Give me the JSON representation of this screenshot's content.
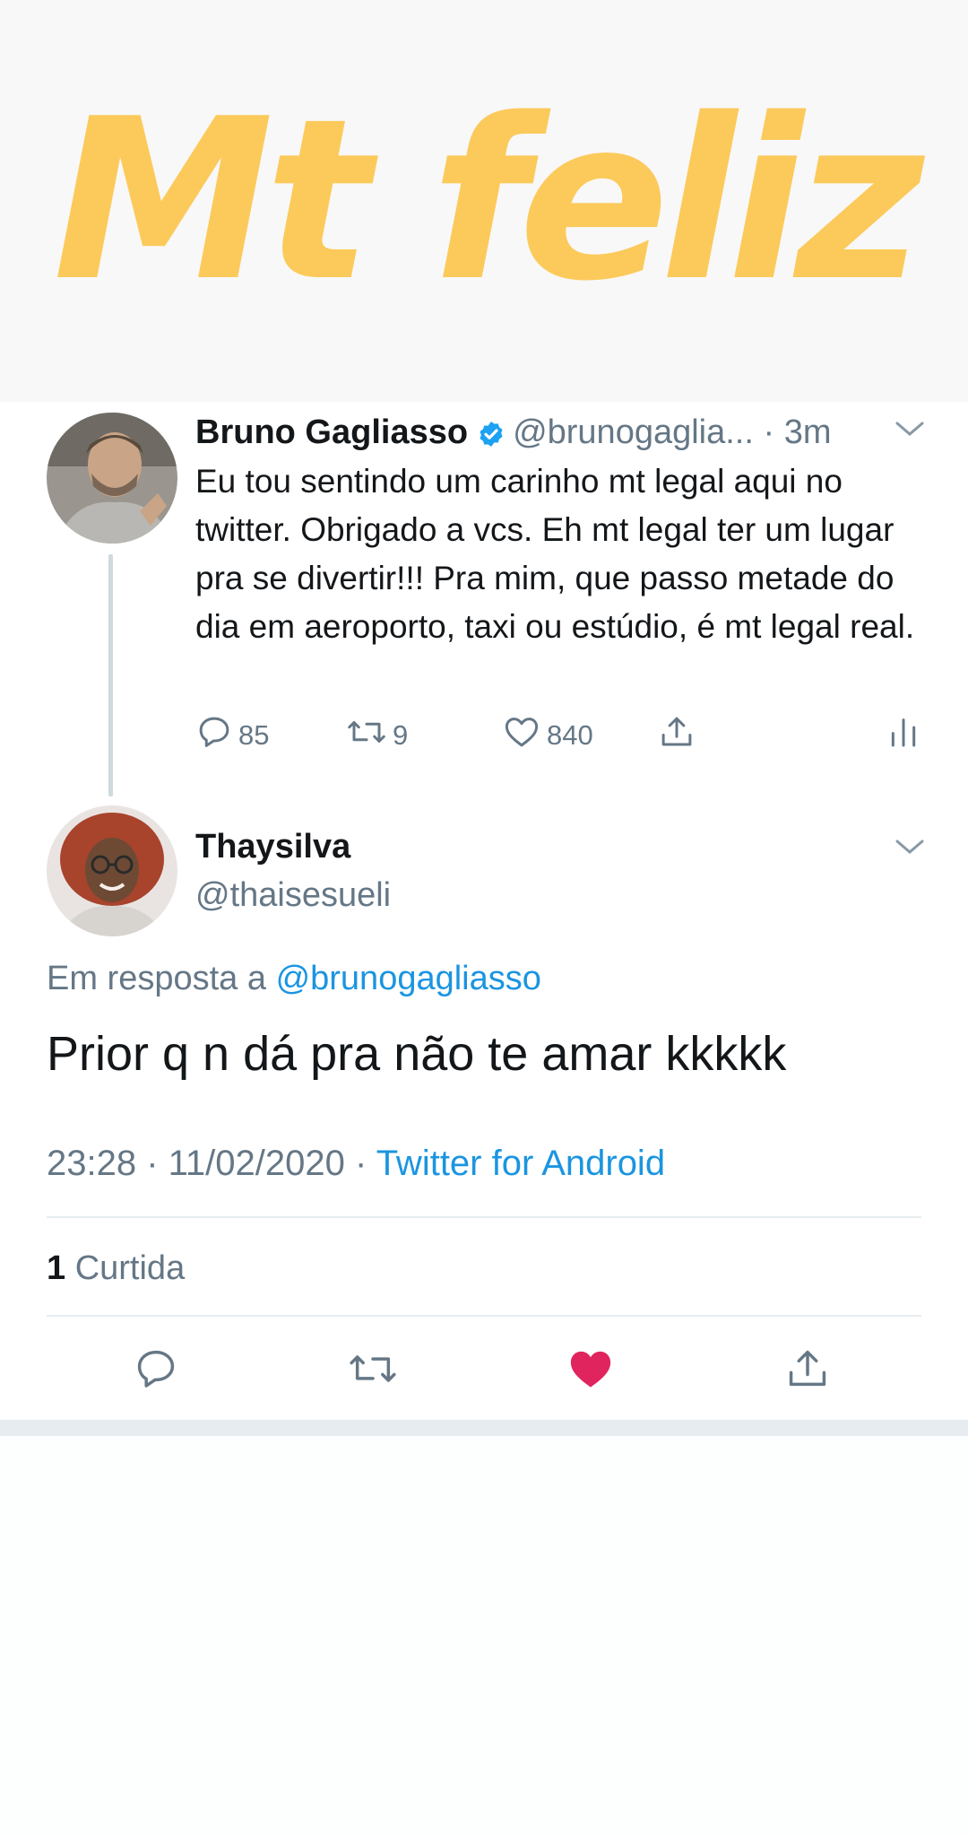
{
  "story": {
    "caption": "Mt feliz",
    "caption_color": "#fcca5b"
  },
  "parent_tweet": {
    "display_name": "Bruno Gagliasso",
    "handle": "@brunogaglia...",
    "separator": "·",
    "time_ago": "3m",
    "verified": true,
    "body": "Eu tou sentindo um carinho mt legal aqui no twitter. Obrigado a vcs. Eh mt legal ter um lugar pra se divertir!!! Pra mim, que passo metade do dia em aeroporto, taxi ou estúdio, é mt legal real.",
    "replies": "85",
    "retweets": "9",
    "likes": "840",
    "icons": [
      "reply-icon",
      "retweet-icon",
      "like-icon",
      "share-icon",
      "analytics-icon"
    ]
  },
  "reply_tweet": {
    "display_name": "Thaysilva",
    "handle": "@thaisesueli",
    "reply_prefix": "Em resposta a",
    "reply_mention": "@brunogagliasso",
    "body": "Prior q n dá pra não te amar kkkkk",
    "timestamp": "23:28 · 11/02/2020 ·",
    "source": "Twitter for Android",
    "like_count": "1",
    "like_label": "Curtida",
    "liked": true,
    "icons": [
      "reply-icon",
      "retweet-icon",
      "heart-filled-icon",
      "share-icon"
    ]
  },
  "colors": {
    "text_primary": "#14171a",
    "text_secondary": "#657786",
    "link_blue": "#1b95e0",
    "verified_blue": "#1da1f2",
    "like_red": "#e0245e",
    "border": "#e6ecf0"
  }
}
